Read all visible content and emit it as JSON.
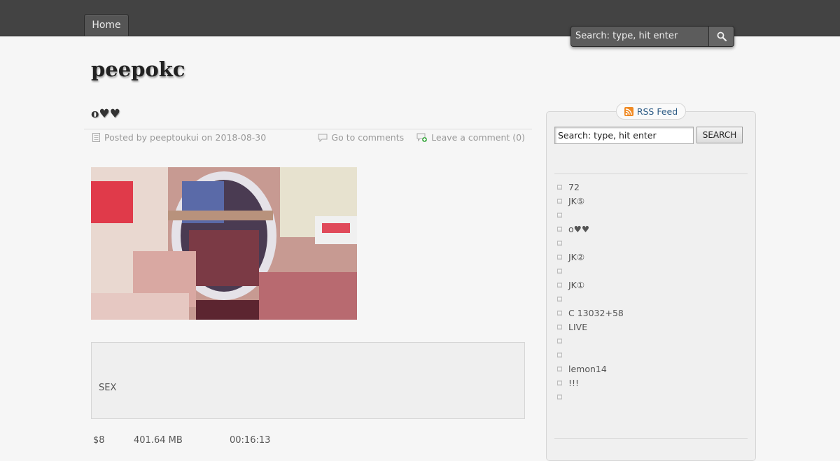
{
  "nav": {
    "home_label": "Home"
  },
  "top_search": {
    "placeholder": "Search: type, hit enter"
  },
  "site": {
    "title": "peepokc"
  },
  "post": {
    "title": "o♥♥",
    "meta": {
      "posted_by": "Posted by peeptoukui on 2018-08-30",
      "go_to_comments": "Go to comments",
      "leave_comment": "Leave a comment (0)"
    },
    "box_text": "SEX",
    "stats": [
      "$8",
      "401.64 MB",
      "00:16:13"
    ]
  },
  "sidebar": {
    "rss_label": "RSS Feed",
    "search_value": "Search: type, hit enter",
    "search_button": "SEARCH",
    "items": [
      "72",
      "JK⑤",
      "",
      "o♥♥",
      "",
      "JK②",
      "",
      "JK①",
      "",
      "C 13032+58",
      "LIVE",
      "",
      "",
      "lemon14",
      "!!!",
      ""
    ]
  },
  "colors": {
    "topbar": "#434343",
    "background": "#f6f6f6",
    "link": "#2b5a84",
    "rss_orange": "#f08a24"
  }
}
